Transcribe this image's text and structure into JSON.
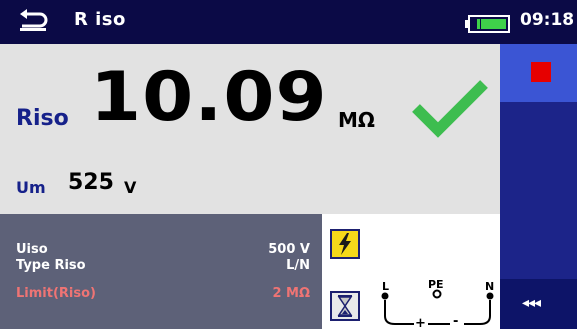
{
  "header": {
    "title": "R iso",
    "clock": "09:18",
    "icons": {
      "back": "back-arrow-icon",
      "battery": "battery-icon"
    }
  },
  "result": {
    "main_label": "Riso",
    "main_value": "10.09",
    "main_unit": "MΩ",
    "status_icon": "check-icon",
    "status_color": "#3dbd4f",
    "sub_label": "Um",
    "sub_value": "525",
    "sub_unit": "V"
  },
  "parameters": [
    {
      "label": "Uiso",
      "value": "500 V"
    },
    {
      "label": "Type Riso",
      "value": "L/N"
    },
    {
      "label": "Limit(Riso)",
      "value": "2 MΩ",
      "color": "#ef7474"
    }
  ],
  "terminals": {
    "labels": [
      "L",
      "PE",
      "N"
    ],
    "polarity": [
      "+",
      "-"
    ],
    "icons": {
      "warning": "high-voltage-warning-icon",
      "timer": "hourglass-icon"
    }
  },
  "sidebar": {
    "stop_icon": "stop-icon",
    "back_label": "◂◂◂",
    "colors": {
      "active": "#3b55d4",
      "panel": "#1c2489",
      "stop": "#e60000"
    }
  }
}
